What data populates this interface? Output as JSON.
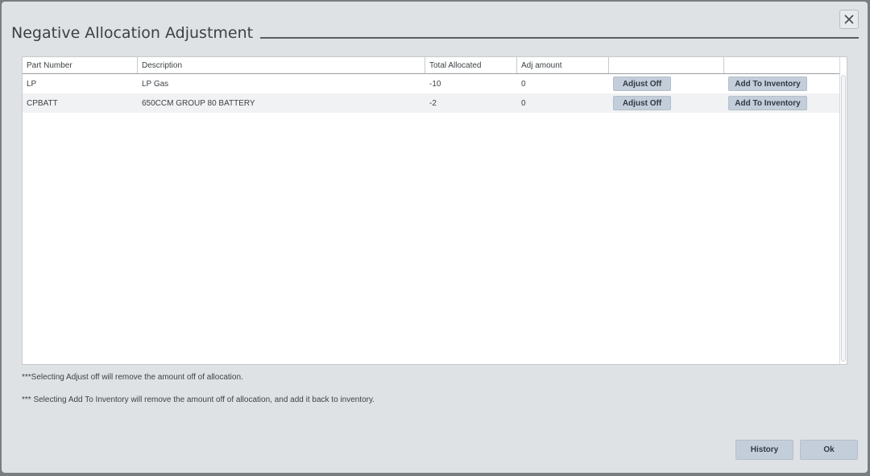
{
  "dialog": {
    "title": "Negative Allocation Adjustment",
    "close_icon": "close-icon"
  },
  "grid": {
    "columns": [
      "Part Number",
      "Description",
      "Total Allocated",
      "Adj amount",
      "",
      ""
    ],
    "rows": [
      {
        "part_number": "LP",
        "description": "LP Gas",
        "total_allocated": "-10",
        "adj_amount": "0",
        "adjust_label": "Adjust Off",
        "inventory_label": "Add To Inventory"
      },
      {
        "part_number": "CPBATT",
        "description": "650CCM GROUP 80 BATTERY",
        "total_allocated": "-2",
        "adj_amount": "0",
        "adjust_label": "Adjust Off",
        "inventory_label": "Add To Inventory"
      }
    ]
  },
  "notes": {
    "adjust_note": "***Selecting Adjust off will remove the amount off of allocation.",
    "inventory_note": "*** Selecting Add To Inventory will remove the amount off of allocation, and add it back to inventory."
  },
  "footer": {
    "history_label": "History",
    "ok_label": "Ok"
  },
  "colors": {
    "dialog_bg": "#dfe2e5",
    "button_bg": "#c3ceda",
    "row_alt": "#f1f2f3"
  }
}
